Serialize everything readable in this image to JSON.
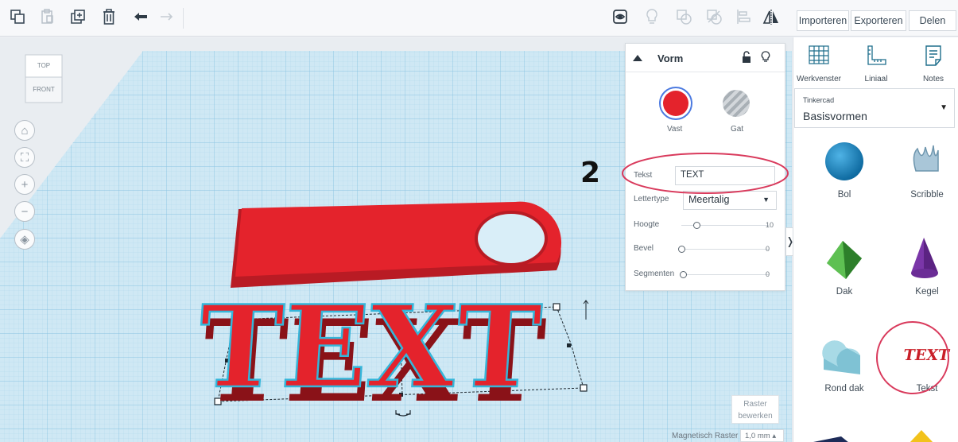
{
  "colors": {
    "accent_red": "#e4232c",
    "highlight_ring": "#d93a5c",
    "grid_blue": "#bcdff0",
    "selection_outline": "#35b6da"
  },
  "toolbar": {
    "icons": [
      "copy-icon",
      "paste-icon",
      "duplicate-icon",
      "delete-icon",
      "undo-icon",
      "redo-icon",
      "show-hidden-icon",
      "lightbulb-icon",
      "group-icon",
      "ungroup-icon",
      "align-icon",
      "mirror-icon"
    ],
    "import_label": "Importeren",
    "export_label": "Exporteren",
    "share_label": "Delen"
  },
  "viewcube": {
    "top": "TOP",
    "front": "FRONT"
  },
  "inspector": {
    "title": "Vorm",
    "solid_label": "Vast",
    "hole_label": "Gat",
    "text_label": "Tekst",
    "text_value": "TEXT",
    "font_label": "Lettertype",
    "font_value": "Meertalig",
    "height_label": "Hoogte",
    "height_value": "10",
    "bevel_label": "Bevel",
    "bevel_value": "0",
    "segments_label": "Segmenten",
    "segments_value": "0"
  },
  "annotation_number": "2",
  "canvas_text": "TEXT",
  "viewport": {
    "edit_grid_line1": "Raster",
    "edit_grid_line2": "bewerken",
    "snap_grid_label": "Magnetisch Raster",
    "snap_grid_value": "1,0 mm"
  },
  "sidebar": {
    "tools": [
      {
        "label": "Werkvenster",
        "icon": "workplane-icon"
      },
      {
        "label": "Liniaal",
        "icon": "ruler-icon"
      },
      {
        "label": "Notes",
        "icon": "notes-icon"
      }
    ],
    "library_small": "Tinkercad",
    "library_name": "Basisvormen",
    "shapes": [
      {
        "label": "Bol"
      },
      {
        "label": "Scribble"
      },
      {
        "label": "Dak"
      },
      {
        "label": "Kegel"
      },
      {
        "label": "Rond dak"
      },
      {
        "label": "Tekst",
        "thumb_text": "TEXT"
      }
    ]
  }
}
